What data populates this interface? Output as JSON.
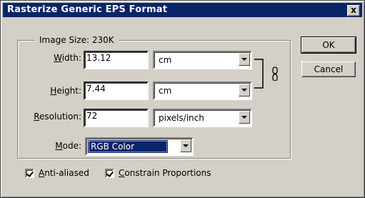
{
  "window": {
    "title": "Rasterize Generic EPS Format",
    "close_glyph": "x"
  },
  "image_size": {
    "label": "Image Size: 230K"
  },
  "width": {
    "label_prefix": "",
    "label_underlined": "W",
    "label_rest": "idth:",
    "value": "13.12",
    "unit": "cm"
  },
  "height": {
    "label_underlined": "H",
    "label_rest": "eight:",
    "value": "7.44",
    "unit": "cm"
  },
  "resolution": {
    "label_underlined": "R",
    "label_rest": "esolution:",
    "value": "72",
    "unit": "pixels/inch"
  },
  "mode": {
    "label_underlined": "M",
    "label_rest": "ode:",
    "value": "RGB Color"
  },
  "buttons": {
    "ok": "OK",
    "cancel": "Cancel"
  },
  "checkboxes": {
    "anti_aliased": {
      "underlined": "A",
      "rest": "nti-aliased",
      "checked": true
    },
    "constrain": {
      "underlined": "C",
      "rest": "onstrain Proportions",
      "checked": true
    }
  },
  "icons": {
    "link": "chain-link-icon"
  },
  "colors": {
    "titlebar": "#0a246a",
    "face": "#d4d0c8",
    "highlight": "#0a246a"
  }
}
